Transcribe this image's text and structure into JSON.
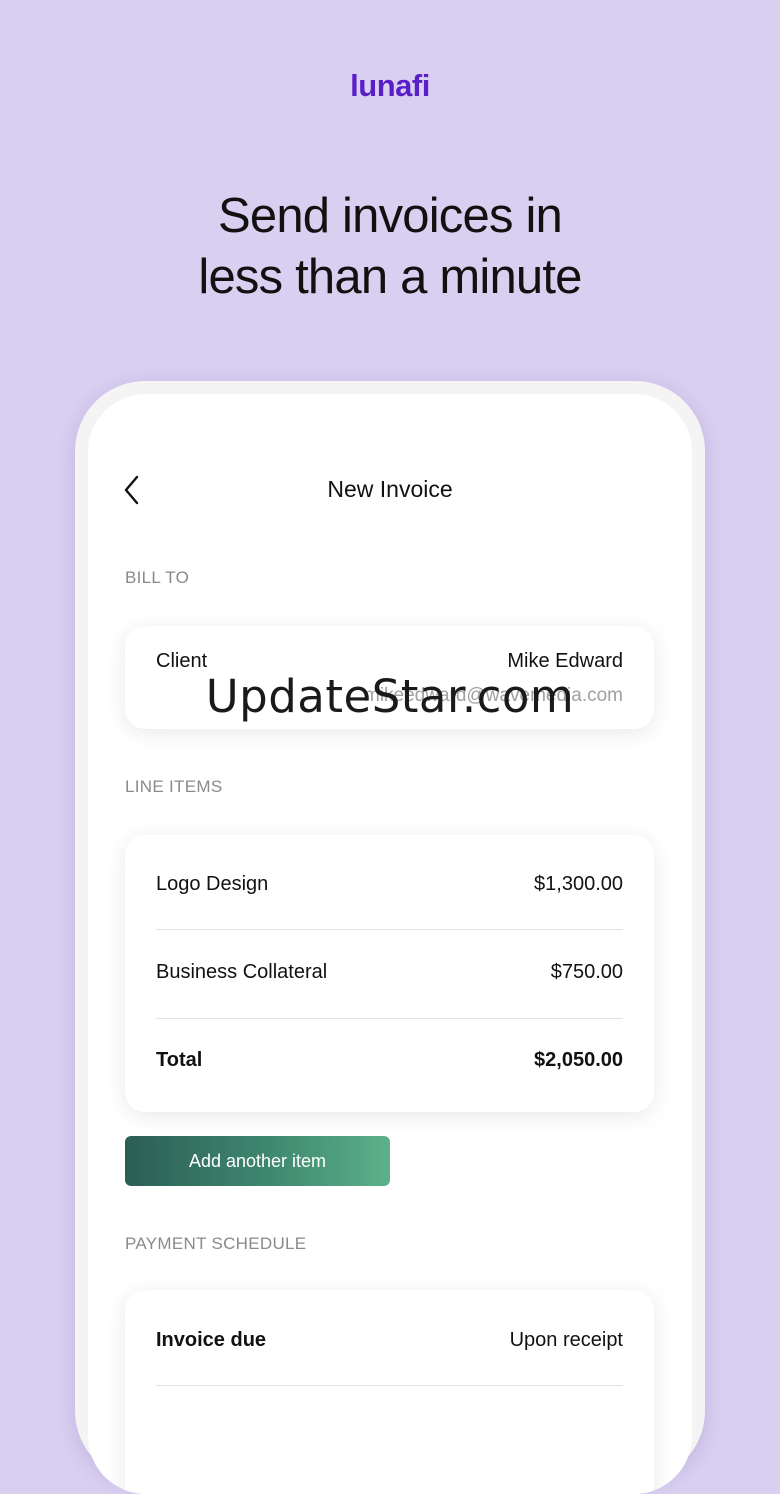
{
  "brand": {
    "logo_text": "lunafi",
    "logo_color": "#5a1ec8"
  },
  "headline": {
    "line1": "Send invoices in",
    "line2": "less than a minute"
  },
  "nav": {
    "back_icon": "chevron-left-icon",
    "title": "New Invoice"
  },
  "bill_to": {
    "section_label": "BILL TO",
    "client_label": "Client",
    "client_name": "Mike Edward",
    "client_email": "mikeedward@wavemedia.com"
  },
  "line_items": {
    "section_label": "LINE ITEMS",
    "items": [
      {
        "name": "Logo Design",
        "amount": "$1,300.00"
      },
      {
        "name": "Business Collateral",
        "amount": "$750.00"
      }
    ],
    "total_label": "Total",
    "total_amount": "$2,050.00"
  },
  "actions": {
    "add_item_label": "Add another item"
  },
  "payment_schedule": {
    "section_label": "PAYMENT SCHEDULE",
    "invoice_due_label": "Invoice due",
    "invoice_due_value": "Upon receipt"
  },
  "watermark": {
    "text": "UpdateStar.com"
  },
  "colors": {
    "background": "#d9cff0",
    "button_start": "#2b5e55",
    "button_end": "#5cb189"
  }
}
